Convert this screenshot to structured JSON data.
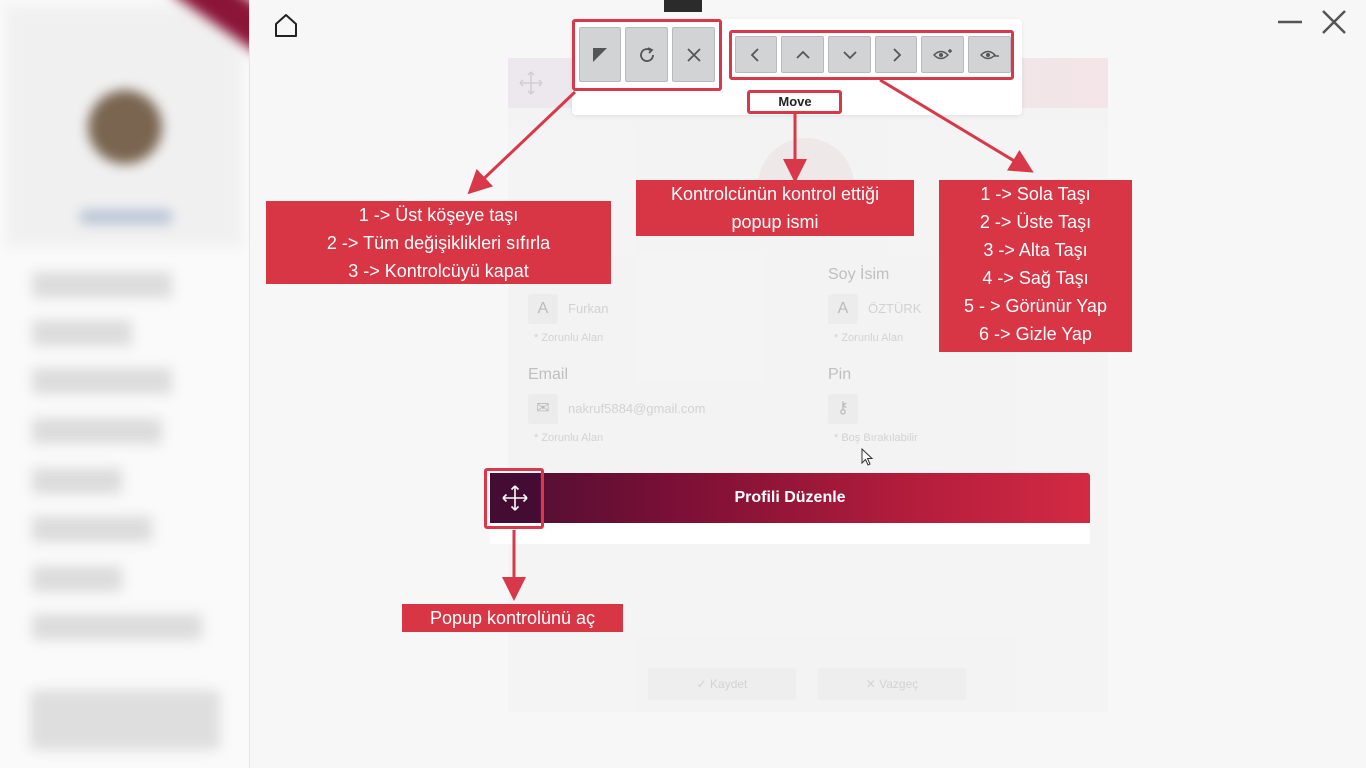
{
  "app": {
    "accent_color": "#d83545",
    "header_gradient": [
      "#4a0f33",
      "#d32a43"
    ]
  },
  "icons": {
    "home": "home-icon",
    "minimize": "minimize-icon",
    "close": "close-icon",
    "move": "move-arrows-icon"
  },
  "controller": {
    "current_popup_label": "Move",
    "buttons_left": [
      "corner-icon",
      "refresh-icon",
      "close-icon"
    ],
    "buttons_right": [
      "chevron-left-icon",
      "chevron-up-icon",
      "chevron-down-icon",
      "chevron-right-icon",
      "eye-plus-icon",
      "eye-minus-icon"
    ]
  },
  "annotations": {
    "left_group": "1 -> Üst köşeye taşı\n2 -> Tüm değişiklikleri sıfırla\n3 -> Kontrolcüyü kapat",
    "popup_name": "Kontrolcünün kontrol ettiği\npopup ismi",
    "right_group": "1 -> Sola Taşı\n2 -> Üste Taşı\n3 -> Alta Taşı\n4 -> Sağ Taşı\n5 - > Görünür Yap\n6 -> Gizle Yap",
    "open_control": "Popup kontrolünü aç"
  },
  "popup": {
    "title": "Profili Düzenle"
  },
  "background_form": {
    "surname_label": "Soy İsim",
    "first_name_value": "Furkan",
    "surname_value": "ÖZTÜRK",
    "required_hint": "* Zorunlu Alan",
    "email_label": "Email",
    "email_value": "nakruf5884@gmail.com",
    "pin_label": "Pin",
    "pin_hint": "* Boş Bırakılabilir",
    "save_label": "Kaydet",
    "cancel_label": "Vazgeç"
  }
}
